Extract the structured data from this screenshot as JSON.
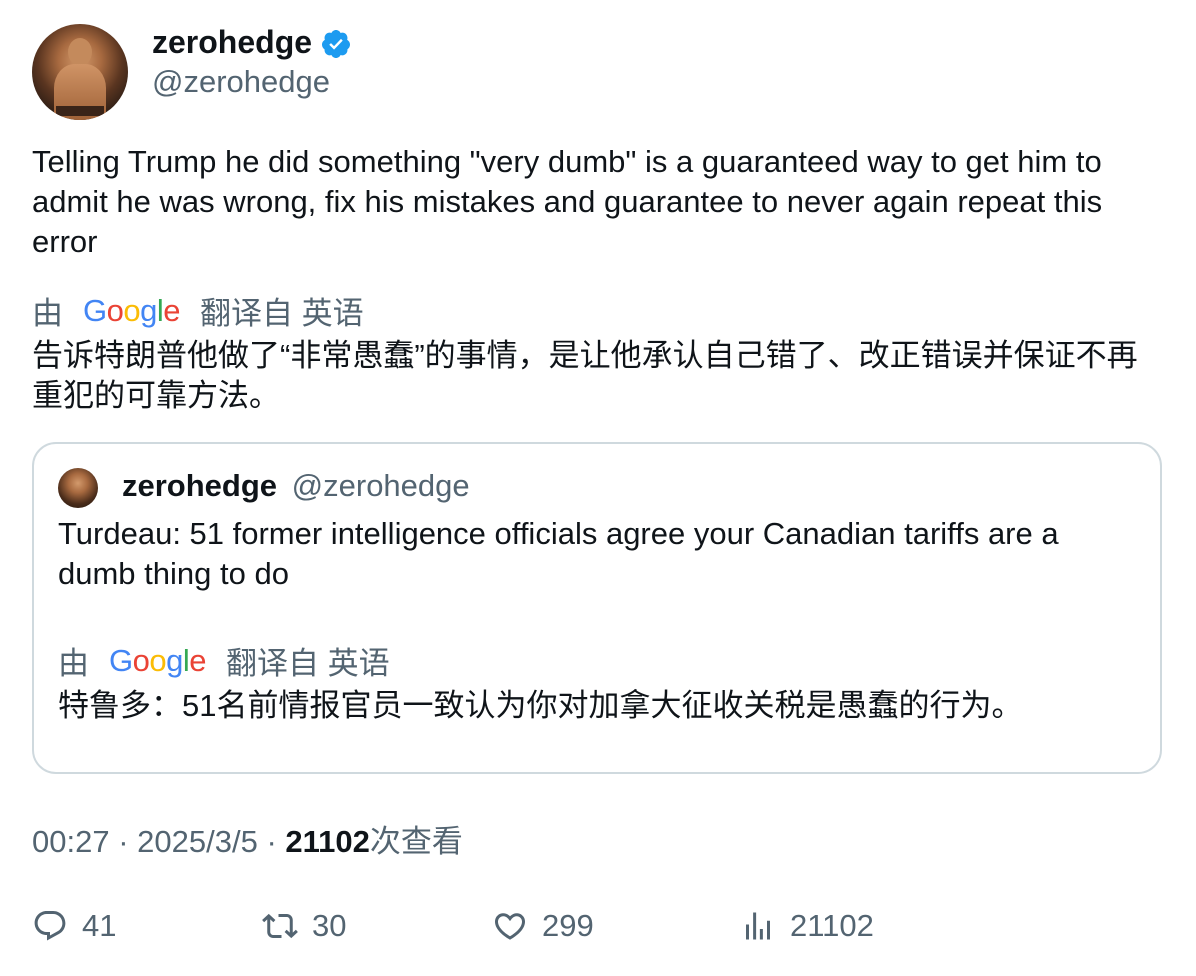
{
  "author": {
    "name": "zerohedge",
    "handle": "@zerohedge"
  },
  "tweet": {
    "text": "Telling Trump he did something \"very dumb\" is a guaranteed way to get him to admit he was wrong, fix his mistakes and guarantee to never again repeat this error"
  },
  "translation": {
    "by": "由",
    "provider": "Google",
    "from_label": "翻译自 英语",
    "text": "告诉特朗普他做了“非常愚蠢”的事情，是让他承认自己错了、改正错误并保证不再重犯的可靠方法。"
  },
  "quote": {
    "name": "zerohedge",
    "handle": "@zerohedge",
    "text": "Turdeau: 51 former intelligence officials agree your Canadian tariffs are a dumb thing to do",
    "translation": {
      "by": "由",
      "provider": "Google",
      "from_label": "翻译自 英语",
      "text": "特鲁多：51名前情报官员一致认为你对加拿大征收关税是愚蠢的行为。"
    }
  },
  "meta": {
    "time": "00:27",
    "sep": "·",
    "date": "2025/3/5",
    "views": "21102",
    "views_label": "次查看"
  },
  "actions": {
    "replies": "41",
    "retweets": "30",
    "likes": "299",
    "views": "21102"
  },
  "colors": {
    "verified": "#1d9bf0",
    "secondary_text": "#536471",
    "border": "#cfd9de"
  }
}
